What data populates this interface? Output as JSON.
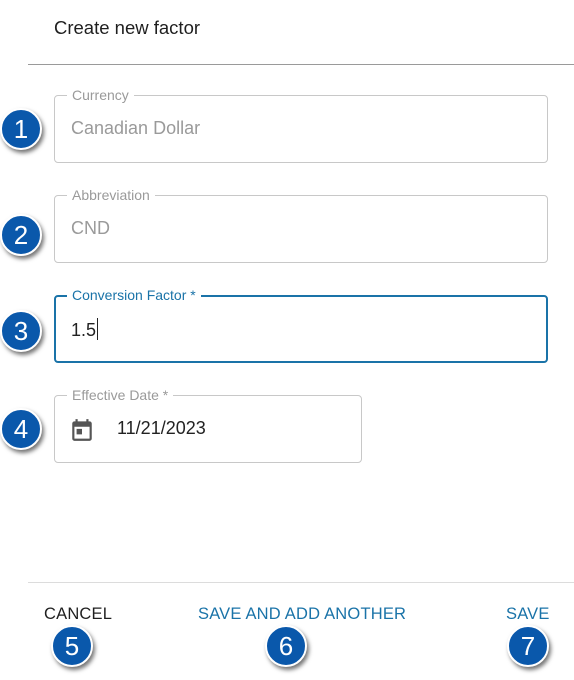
{
  "dialog": {
    "title": "Create new factor"
  },
  "fields": {
    "currency": {
      "label": "Currency",
      "value": "Canadian Dollar",
      "disabled": true
    },
    "abbreviation": {
      "label": "Abbreviation",
      "value": "CND",
      "disabled": true
    },
    "conversion_factor": {
      "label": "Conversion Factor *",
      "value": "1.5",
      "focused": true
    },
    "effective_date": {
      "label": "Effective Date *",
      "value": "11/21/2023",
      "icon": "calendar-icon"
    }
  },
  "actions": {
    "cancel": "CANCEL",
    "save_and_add_another": "SAVE AND ADD ANOTHER",
    "save": "SAVE"
  },
  "callouts": [
    "1",
    "2",
    "3",
    "4",
    "5",
    "6",
    "7"
  ],
  "colors": {
    "accent": "#1a73a8",
    "callout": "#0a58ab",
    "disabled_text": "#9a9a9a"
  }
}
